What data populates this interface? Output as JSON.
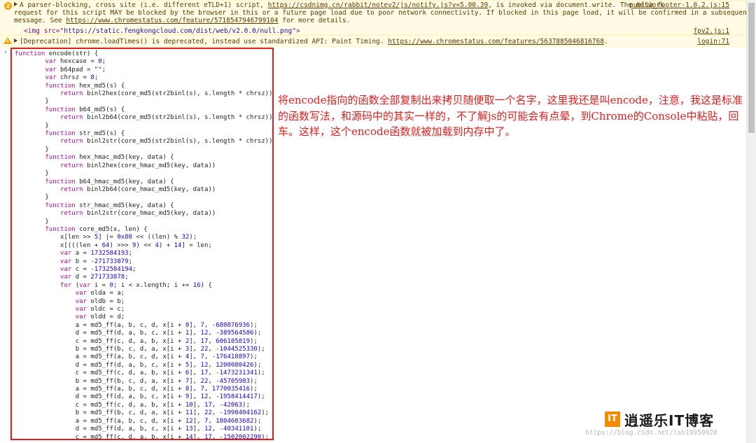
{
  "warnings": [
    {
      "count": "2",
      "line1": "A parser-blocking, cross site (i.e. different eTLD+1) script, ",
      "link1": "https://csdnimg.cn/rabbit/notev2/js/notify.js?v=5.00.39",
      "line1_end": ", is invoked via document.write. The network",
      "line2": "request for this script MAY be blocked by the browser in this or a future page load due to poor network connectivity. If blocked in this page load, it will be confirmed in a subsequent console",
      "line3_start": "message. See ",
      "link2": "https://www.chromestatus.com/feature/5718547946799104",
      "line3_end": " for more details.",
      "source": "publib_footer-1.0.2.js:15",
      "img_tag_open": "<img src=",
      "img_src": "\"https://static.fengkongcloud.com/dist/web/v2.0.0/null.png\"",
      "img_tag_close": ">",
      "source2": "fpv2.js:1"
    },
    {
      "text": "[Deprecation] chrome.loadTimes() is deprecated, instead use standardized API: Paint Timing. ",
      "link": "https://www.chromestatus.com/features/5637885046816768",
      "text_end": ".",
      "source": "login:71"
    }
  ],
  "code_lines": [
    "function encode(str) {",
    "        var hexcase = 0;",
    "        var b64pad = \"\";",
    "        var chrsz = 8;",
    "        function hex_md5(s) {",
    "            return binl2hex(core_md5(str2binl(s), s.length * chrsz))",
    "        }",
    "        function b64_md5(s) {",
    "            return binl2b64(core_md5(str2binl(s), s.length * chrsz))",
    "        }",
    "        function str_md5(s) {",
    "            return binl2str(core_md5(str2binl(s), s.length * chrsz))",
    "        }",
    "        function hex_hmac_md5(key, data) {",
    "            return binl2hex(core_hmac_md5(key, data))",
    "        }",
    "        function b64_hmac_md5(key, data) {",
    "            return binl2b64(core_hmac_md5(key, data))",
    "        }",
    "        function str_hmac_md5(key, data) {",
    "            return binl2str(core_hmac_md5(key, data))",
    "        }",
    "        function core_md5(x, len) {",
    "            x[len >> 5] |= 0x80 << ((len) % 32);",
    "            x[(((len + 64) >>> 9) << 4) + 14] = len;",
    "            var a = 1732584193;",
    "            var b = -271733879;",
    "            var c = -1732584194;",
    "            var d = 271733878;",
    "            for (var i = 0; i < x.length; i += 16) {",
    "                var olda = a;",
    "                var oldb = b;",
    "                var oldc = c;",
    "                var oldd = d;",
    "                a = md5_ff(a, b, c, d, x[i + 0], 7, -680876936);",
    "                d = md5_ff(d, a, b, c, x[i + 1], 12, -389564586);",
    "                c = md5_ff(c, d, a, b, x[i + 2], 17, 606105819);",
    "                b = md5_ff(b, c, d, a, x[i + 3], 22, -1044525330);",
    "                a = md5_ff(a, b, c, d, x[i + 4], 7, -176418897);",
    "                d = md5_ff(d, a, b, c, x[i + 5], 12, 1200080426);",
    "                c = md5_ff(c, d, a, b, x[i + 6], 17, -1473231341);",
    "                b = md5_ff(b, c, d, a, x[i + 7], 22, -45705983);",
    "                a = md5_ff(a, b, c, d, x[i + 8], 7, 1770035416);",
    "                d = md5_ff(d, a, b, c, x[i + 9], 12, -1958414417);",
    "                c = md5_ff(c, d, a, b, x[i + 10], 17, -42063);",
    "                b = md5_ff(b, c, d, a, x[i + 11], 22, -1990404162);",
    "                a = md5_ff(a, b, c, d, x[i + 12], 7, 1804603682);",
    "                d = md5_ff(d, a, b, c, x[i + 13], 12, -40341101);",
    "                c = md5_ff(c, d, a, b, x[i + 14], 17, -1502002290);"
  ],
  "annotation": "将encode指向的函数全部复制出来拷贝随便取一个名字，这里我还是叫encode，注意，我这是标准的函数写法，和源码中的其实一样的，不了解js的可能会有点晕，到Chrome的Console中粘贴，回车。这样，这个encode函数就被加载到内存中了。",
  "watermark": {
    "logo": "IT",
    "brand": "逍遥乐IT博客",
    "url": "https://blog.csdn.net/lsh19950928"
  },
  "colors": {
    "highlight_border": "#e01e1e",
    "annotation_text": "#e01e1e",
    "warning_bg": "#fffbe5"
  },
  "icons": [
    "warning-count-badge-icon",
    "warning-triangle-icon",
    "expand-arrow-icon",
    "console-prompt-icon"
  ]
}
